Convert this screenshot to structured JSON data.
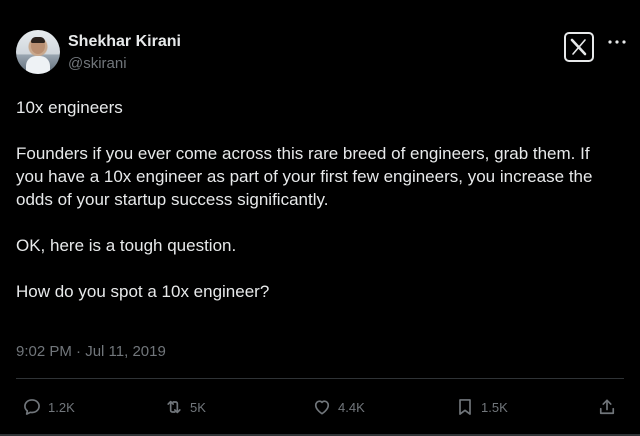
{
  "author": {
    "name": "Shekhar Kirani",
    "handle": "@skirani"
  },
  "tweet": {
    "paragraphs": [
      "10x engineers",
      "Founders if you ever come across this rare breed of engineers, grab them. If you have a 10x engineer as part of your first few engineers, you increase the odds of your startup success significantly.",
      "OK, here is a tough question.",
      "How do you spot a 10x engineer?"
    ],
    "timestamp": "9:02 PM · Jul 11, 2019"
  },
  "actions": {
    "replies": "1.2K",
    "retweets": "5K",
    "likes": "4.4K",
    "bookmarks": "1.5K"
  },
  "icons": {
    "logo": "x-logo-icon",
    "more": "more-options-icon",
    "reply": "reply-icon",
    "retweet": "retweet-icon",
    "like": "heart-icon",
    "bookmark": "bookmark-icon",
    "share": "share-icon"
  },
  "colors": {
    "background": "#000000",
    "text": "#e7e9ea",
    "secondary": "#71767b",
    "divider": "#2f3336"
  }
}
